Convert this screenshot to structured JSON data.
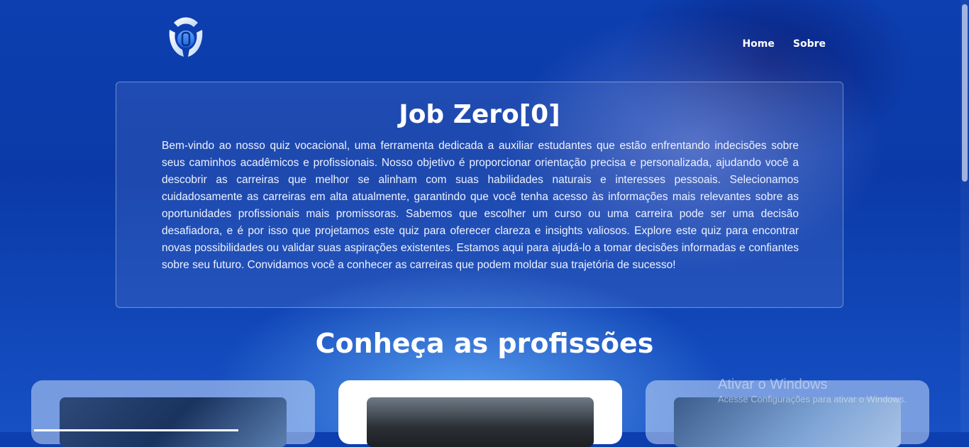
{
  "header": {
    "logo_icon": "job-zero-logo-icon",
    "nav": [
      {
        "label": "Home"
      },
      {
        "label": "Sobre"
      }
    ]
  },
  "intro": {
    "title": "Job Zero[0]",
    "text": "Bem-vindo ao nosso quiz vocacional, uma ferramenta dedicada a auxiliar estudantes que estão enfrentando indecisões sobre seus caminhos acadêmicos e profissionais. Nosso objetivo é proporcionar orientação precisa e personalizada, ajudando você a descobrir as carreiras que melhor se alinham com suas habilidades naturais e interesses pessoais. Selecionamos cuidadosamente as carreiras em alta atualmente, garantindo que você tenha acesso às informações mais relevantes sobre as oportunidades profissionais mais promissoras. Sabemos que escolher um curso ou uma carreira pode ser uma decisão desafiadora, e é por isso que projetamos este quiz para oferecer clareza e insights valiosos. Explore este quiz para encontrar novas possibilidades ou validar suas aspirações existentes. Estamos aqui para ajudá-lo a tomar decisões informadas e confiantes sobre seu futuro. Convidamos você a conhecer as carreiras que podem moldar sua trajetória de sucesso!"
  },
  "professions": {
    "title": "Conheça as profissões"
  },
  "watermark": {
    "line1": "Ativar o Windows",
    "line2": "Acesse Configurações para ativar o Windows."
  },
  "colors": {
    "background": "#0d3fb0",
    "text": "#ffffff",
    "card_active": "#ffffff"
  }
}
